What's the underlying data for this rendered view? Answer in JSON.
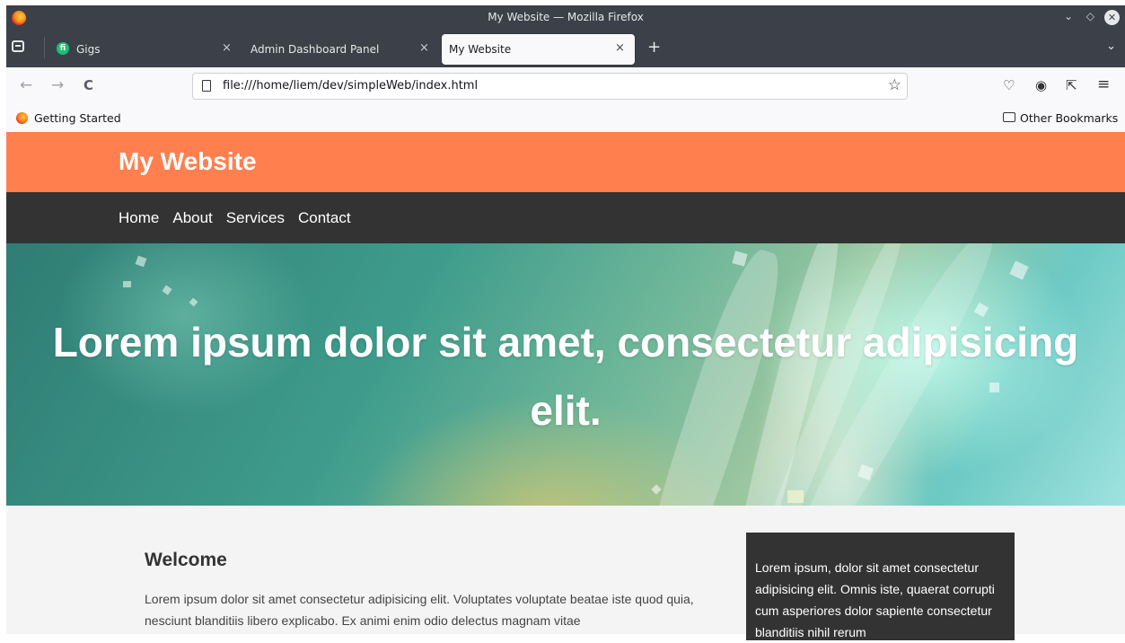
{
  "window": {
    "title": "My Website — Mozilla Firefox",
    "controls": [
      "⌄",
      "◇",
      "✕"
    ]
  },
  "tabs": [
    {
      "label": "Gigs",
      "icon": "fiverr-icon",
      "close": "×"
    },
    {
      "label": "Admin Dashboard Panel",
      "close": "×"
    },
    {
      "label": "My Website",
      "close": "×",
      "active": true
    }
  ],
  "toolbar": {
    "back": "←",
    "forward": "→",
    "reload": "C",
    "url": "file:///home/liem/dev/simpleWeb/index.html",
    "bookmark_star": "☆",
    "new_tab": "+",
    "tab_overflow": "⌄",
    "pocket": "♡",
    "account": "◉",
    "extensions": "⇱",
    "menu": "≡"
  },
  "bookmarks": {
    "left": "Getting Started",
    "right": "Other Bookmarks"
  },
  "site": {
    "brand": "My Website",
    "nav": [
      "Home",
      "About",
      "Services",
      "Contact"
    ],
    "hero_headline": "Lorem ipsum dolor sit amet, consectetur adipisicing elit.",
    "welcome_title": "Welcome",
    "welcome_text": "Lorem ipsum dolor sit amet consectetur adipisicing elit. Voluptates voluptate beatae iste quod quia, nesciunt blanditiis libero explicabo. Ex animi enim odio delectus magnam vitae",
    "sidebar_text": "Lorem ipsum, dolor sit amet consectetur adipisicing elit. Omnis iste, quaerat corrupti cum asperiores dolor sapiente consectetur blanditiis nihil rerum"
  },
  "colors": {
    "header": "#ff7f4f",
    "nav": "#333333",
    "content_bg": "#f4f4f4",
    "sidebar": "#333333"
  }
}
